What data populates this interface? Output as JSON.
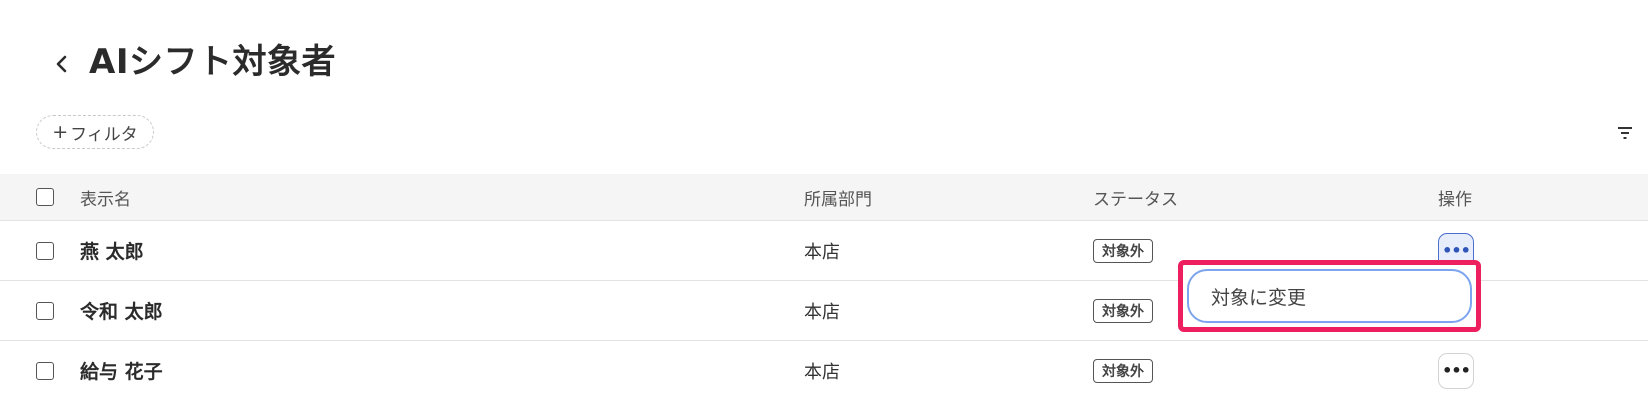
{
  "page": {
    "title": "AIシフト対象者",
    "back_icon": "chevron-left-icon"
  },
  "toolbar": {
    "filter_plus": "+",
    "filter_label": "フィルタ",
    "sort_icon": "filter-lines-icon"
  },
  "table": {
    "headers": {
      "name": "表示名",
      "department": "所属部門",
      "status": "ステータス",
      "operations": "操作"
    },
    "rows": [
      {
        "name": "燕 太郎",
        "department": "本店",
        "status": "対象外",
        "ops_icon": "more-horizontal-icon",
        "menu_open": true
      },
      {
        "name": "令和 太郎",
        "department": "本店",
        "status": "対象外",
        "ops_icon": "more-horizontal-icon",
        "menu_open": false
      },
      {
        "name": "給与 花子",
        "department": "本店",
        "status": "対象外",
        "ops_icon": "more-horizontal-icon",
        "menu_open": false
      }
    ]
  },
  "context_menu": {
    "items": [
      {
        "label": "対象に変更"
      }
    ],
    "highlight_color": "#ee1f5f"
  },
  "ops_button_text": "•••"
}
